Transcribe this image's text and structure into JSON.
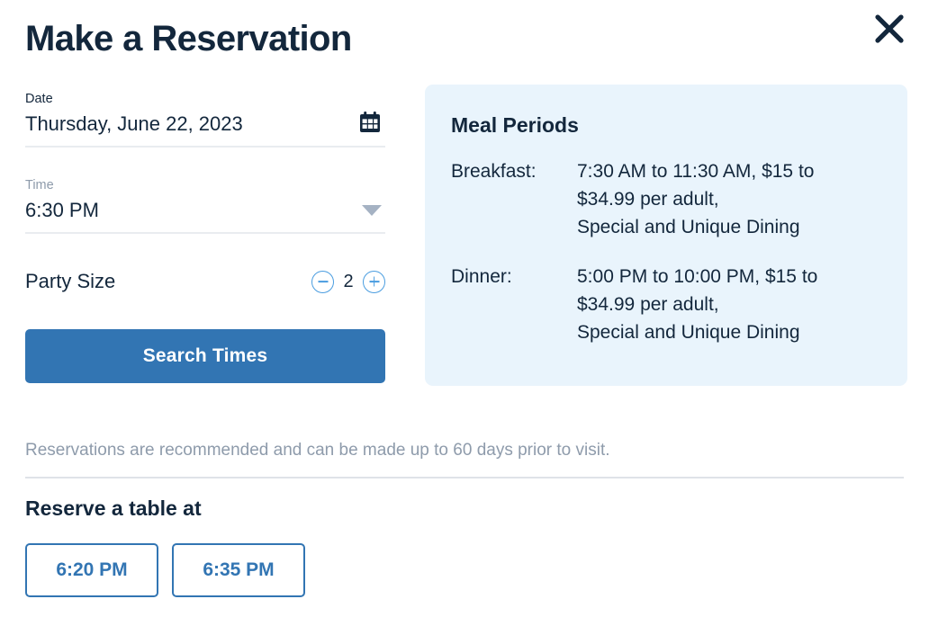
{
  "dialog": {
    "title": "Make a Reservation",
    "close_icon": "close-icon"
  },
  "form": {
    "date": {
      "label": "Date",
      "value": "Thursday, June 22, 2023",
      "icon": "calendar-icon"
    },
    "time": {
      "label": "Time",
      "value": "6:30 PM",
      "icon": "chevron-down-icon"
    },
    "party": {
      "label": "Party Size",
      "count": "2",
      "decrement_icon": "minus-circle-icon",
      "increment_icon": "plus-circle-icon"
    },
    "search_label": "Search Times"
  },
  "disclaimer": "Reservations are recommended and can be made up to 60 days prior to visit.",
  "reserve": {
    "title": "Reserve a table at",
    "slots": [
      {
        "label": "6:20 PM"
      },
      {
        "label": "6:35 PM"
      }
    ]
  },
  "meal_periods": {
    "title": "Meal Periods",
    "rows": [
      {
        "name": "Breakfast:",
        "description": "7:30 AM to 11:30 AM, $15 to\n$34.99 per adult,\nSpecial and Unique Dining"
      },
      {
        "name": "Dinner:",
        "description": "5:00 PM to 10:00 PM, $15 to\n$34.99 per adult,\nSpecial and Unique Dining"
      }
    ]
  },
  "colors": {
    "accent_blue": "#3275b3",
    "panel_blue": "#e9f4fc",
    "ink": "#13273c",
    "muted": "#8e9bab",
    "stepper_blue": "#4a9de0"
  }
}
